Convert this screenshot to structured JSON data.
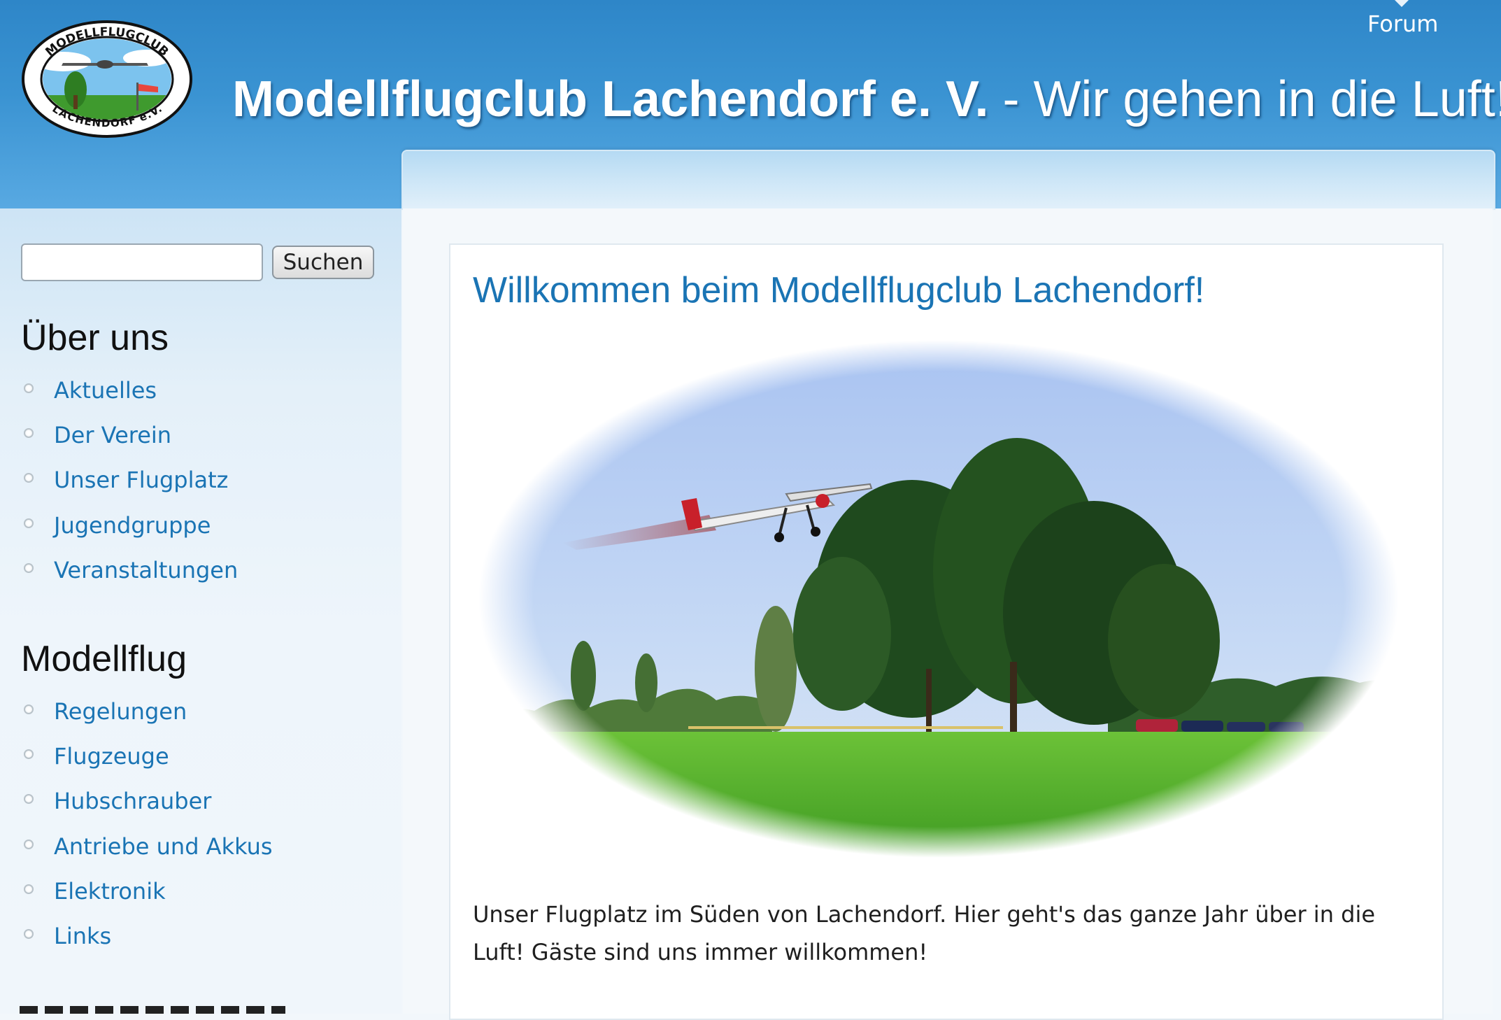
{
  "header": {
    "logo": {
      "text_top": "MODELLFLUGCLUB",
      "text_bottom": "LACHENDORF e.V."
    },
    "site_name": "Modellflugclub Lachendorf e. V.",
    "slogan": " - Wir gehen in die Luft!",
    "nav": {
      "forum": "Forum"
    }
  },
  "sidebar": {
    "search": {
      "value": "",
      "button": "Suchen"
    },
    "blocks": [
      {
        "title": "Über uns",
        "items": [
          "Aktuelles",
          "Der Verein",
          "Unser Flugplatz",
          "Jugendgruppe",
          "Veranstaltungen"
        ]
      },
      {
        "title": "Modellflug",
        "items": [
          "Regelungen",
          "Flugzeuge",
          "Hubschrauber",
          "Antriebe und Akkus",
          "Elektronik",
          "Links"
        ]
      }
    ]
  },
  "main": {
    "title": "Willkommen beim Modellflugclub Lachendorf!",
    "body": "Unser Flugplatz im Süden von Lachendorf. Hier geht's das ganze Jahr über in die Luft! Gäste sind uns immer willkommen!"
  },
  "colors": {
    "header_blue": "#2e86c8",
    "link_blue": "#1a74b4",
    "grass_green": "#4fae2a",
    "sky_blue": "#b9d2f4"
  }
}
